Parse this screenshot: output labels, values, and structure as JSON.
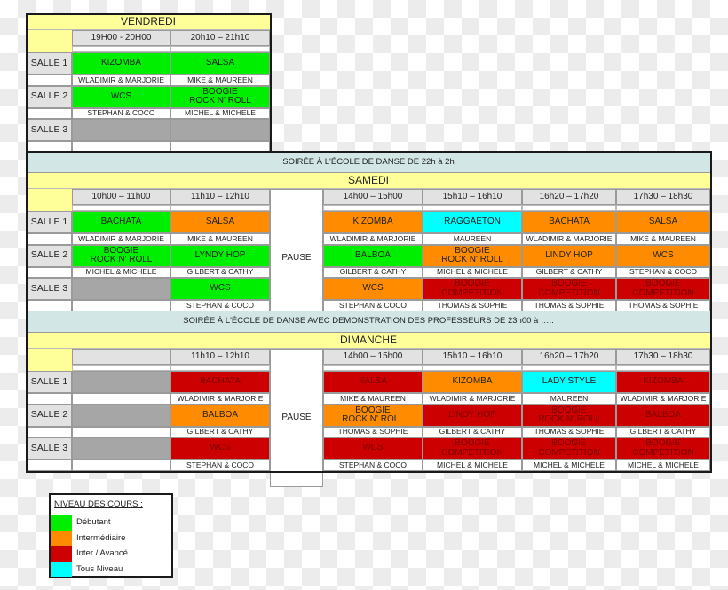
{
  "colors": {
    "debutant": "#00ee00",
    "intermediaire": "#ff8c00",
    "inter_avance": "#cc0000",
    "tous_niveau": "#00ffff",
    "empty": "#a6a6a6",
    "day_header": "#ffff99",
    "soiree": "#d2e6e6"
  },
  "vendredi": {
    "title": "VENDREDI",
    "times": [
      "19H00 - 20H00",
      "20h10 – 21h10"
    ],
    "rooms": [
      {
        "label": "SALLE 1",
        "slots": [
          {
            "course": "KIZOMBA",
            "level": "debutant",
            "teachers": "WLADIMIR & MARJORIE"
          },
          {
            "course": "SALSA",
            "level": "debutant",
            "teachers": "MIKE & MAUREEN"
          }
        ]
      },
      {
        "label": "SALLE 2",
        "slots": [
          {
            "course": "WCS",
            "level": "debutant",
            "teachers": "STEPHAN & COCO"
          },
          {
            "course": "BOOGIE\nROCK N' ROLL",
            "level": "debutant",
            "teachers": "MICHEL & MICHELE"
          }
        ]
      },
      {
        "label": "SALLE 3",
        "slots": [
          {
            "course": "",
            "level": "empty",
            "teachers": ""
          },
          {
            "course": "",
            "level": "empty",
            "teachers": ""
          }
        ]
      }
    ]
  },
  "soiree1": "SOIRÉE À L'ÉCOLE DE DANSE DE 22h à 2h",
  "samedi": {
    "title": "SAMEDI",
    "pause": "PAUSE",
    "times": [
      "10h00 – 11h00",
      "11h10 – 12h10",
      "14h00 – 15h00",
      "15h10 – 16h10",
      "16h20 – 17h20",
      "17h30 – 18h30"
    ],
    "rooms": [
      {
        "label": "SALLE 1",
        "slots": [
          {
            "course": "BACHATA",
            "level": "debutant",
            "teachers": "WLADIMIR & MARJORIE"
          },
          {
            "course": "SALSA",
            "level": "intermediaire",
            "teachers": "MIKE & MAUREEN"
          },
          {
            "course": "KIZOMBA",
            "level": "intermediaire",
            "teachers": "WLADIMIR & MARJORIE"
          },
          {
            "course": "RAGGAETON",
            "level": "tous_niveau",
            "teachers": "MAUREEN"
          },
          {
            "course": "BACHATA",
            "level": "intermediaire",
            "teachers": "WLADIMIR & MARJORIE"
          },
          {
            "course": "SALSA",
            "level": "intermediaire",
            "teachers": "MIKE & MAUREEN"
          }
        ]
      },
      {
        "label": "SALLE 2",
        "slots": [
          {
            "course": "BOOGIE\nROCK N' ROLL",
            "level": "debutant",
            "teachers": "MICHEL & MICHELE"
          },
          {
            "course": "LYNDY HOP",
            "level": "debutant",
            "teachers": "GILBERT & CATHY"
          },
          {
            "course": "BALBOA",
            "level": "debutant",
            "teachers": "GILBERT & CATHY"
          },
          {
            "course": "BOOGIE\nROCK N' ROLL",
            "level": "intermediaire",
            "teachers": "MICHEL & MICHELE"
          },
          {
            "course": "LINDY HOP",
            "level": "intermediaire",
            "teachers": "GILBERT & CATHY"
          },
          {
            "course": "WCS",
            "level": "intermediaire",
            "teachers": "STEPHAN & COCO"
          }
        ]
      },
      {
        "label": "SALLE 3",
        "slots": [
          {
            "course": "",
            "level": "empty",
            "teachers": ""
          },
          {
            "course": "WCS",
            "level": "debutant",
            "teachers": "STEPHAN & COCO"
          },
          {
            "course": "WCS",
            "level": "intermediaire",
            "teachers": "STEPHAN & COCO"
          },
          {
            "course": "BOOGIE\nCOMPETITION",
            "level": "inter_avance",
            "teachers": "THOMAS & SOPHIE"
          },
          {
            "course": "BOOGIE\nCOMPETITION",
            "level": "inter_avance",
            "teachers": "THOMAS & SOPHIE"
          },
          {
            "course": "BOOGIE\nCOMPETITION",
            "level": "inter_avance",
            "teachers": "THOMAS & SOPHIE"
          }
        ]
      }
    ]
  },
  "soiree2": "SOIRÉE À L'ÉCOLE DE DANSE AVEC DEMONSTRATION DES PROFESSEURS DE 23h00 à …..",
  "dimanche": {
    "title": "DIMANCHE",
    "pause": "PAUSE",
    "times": [
      "",
      "11h10 – 12h10",
      "14h00 – 15h00",
      "15h10 – 16h10",
      "16h20 – 17h20",
      "17h30 – 18h30"
    ],
    "rooms": [
      {
        "label": "SALLE 1",
        "slots": [
          {
            "course": "",
            "level": "empty",
            "teachers": ""
          },
          {
            "course": "BACHATA",
            "level": "inter_avance",
            "teachers": "WLADIMIR & MARJORIE"
          },
          {
            "course": "SALSA",
            "level": "inter_avance",
            "teachers": "MIKE & MAUREEN"
          },
          {
            "course": "KIZOMBA",
            "level": "intermediaire",
            "teachers": "WLADIMIR & MARJORIE"
          },
          {
            "course": "LADY STYLE",
            "level": "tous_niveau",
            "teachers": "MAUREEN"
          },
          {
            "course": "KIZOMBA",
            "level": "inter_avance",
            "teachers": "WLADIMIR & MARJORIE"
          }
        ]
      },
      {
        "label": "SALLE 2",
        "slots": [
          {
            "course": "",
            "level": "empty",
            "teachers": ""
          },
          {
            "course": "BALBOA",
            "level": "intermediaire",
            "teachers": "GILBERT & CATHY"
          },
          {
            "course": "BOOGIE\nROCK N' ROLL",
            "level": "intermediaire",
            "teachers": "THOMAS & SOPHIE"
          },
          {
            "course": "LINDY HOP",
            "level": "inter_avance",
            "teachers": "GILBERT & CATHY"
          },
          {
            "course": "BOOGIE\nROCK N' ROLL",
            "level": "inter_avance",
            "teachers": "THOMAS & SOPHIE"
          },
          {
            "course": "BALBOA",
            "level": "inter_avance",
            "teachers": "GILBERT & CATHY"
          }
        ]
      },
      {
        "label": "SALLE 3",
        "slots": [
          {
            "course": "",
            "level": "empty",
            "teachers": ""
          },
          {
            "course": "WCS",
            "level": "inter_avance",
            "teachers": "STEPHAN & COCO"
          },
          {
            "course": "WCS",
            "level": "inter_avance",
            "teachers": "STEPHAN & COCO"
          },
          {
            "course": "BOOGIE\nCOMPETITION",
            "level": "inter_avance",
            "teachers": "MICHEL & MICHELE"
          },
          {
            "course": "BOOGIE\nCOMPETITION",
            "level": "inter_avance",
            "teachers": "MICHEL & MICHELE"
          },
          {
            "course": "BOOGIE\nCOMPETITION",
            "level": "inter_avance",
            "teachers": "MICHEL & MICHELE"
          }
        ]
      }
    ]
  },
  "legend": {
    "title": "NIVEAU DES COURS :",
    "items": [
      {
        "level": "debutant",
        "label": "Débutant"
      },
      {
        "level": "intermediaire",
        "label": "Intermédiaire"
      },
      {
        "level": "inter_avance",
        "label": "Inter / Avancé"
      },
      {
        "level": "tous_niveau",
        "label": "Tous Niveau"
      }
    ]
  }
}
